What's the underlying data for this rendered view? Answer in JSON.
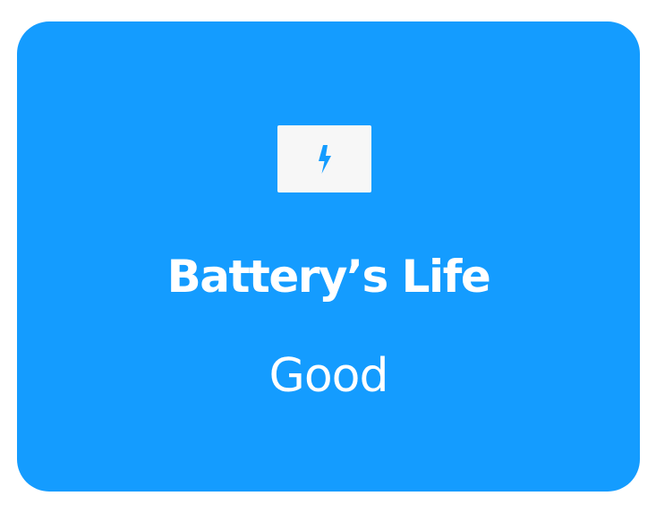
{
  "card": {
    "icon": "lightning-bolt-icon",
    "title": "Battery’s Life",
    "value": "Good"
  },
  "colors": {
    "card_background": "#149cff",
    "icon_background": "#f7f7f7",
    "icon_color": "#149cff",
    "text": "#ffffff"
  }
}
